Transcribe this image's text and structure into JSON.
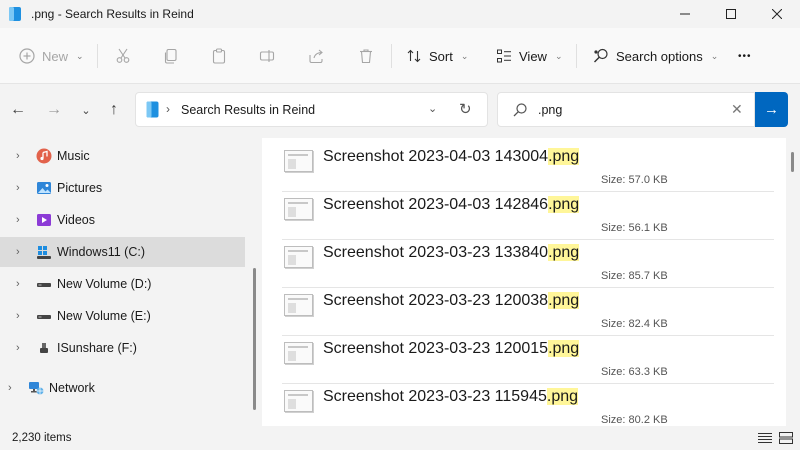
{
  "window": {
    "title": ".png - Search Results in Reind"
  },
  "toolbar": {
    "new_label": "New",
    "sort_label": "Sort",
    "view_label": "View",
    "search_options_label": "Search options",
    "more_label": "•••"
  },
  "address": {
    "path": "Search Results in Reind"
  },
  "search": {
    "value": ".png"
  },
  "nav": {
    "items": [
      {
        "label": "Music",
        "icon": "music-icon"
      },
      {
        "label": "Pictures",
        "icon": "pictures-icon"
      },
      {
        "label": "Videos",
        "icon": "videos-icon"
      },
      {
        "label": "Windows11 (C:)",
        "icon": "system-drive-icon",
        "selected": true
      },
      {
        "label": "New Volume (D:)",
        "icon": "drive-icon"
      },
      {
        "label": "New Volume (E:)",
        "icon": "drive-icon"
      },
      {
        "label": "ISunshare (F:)",
        "icon": "drive-icon"
      },
      {
        "label": "Network",
        "icon": "network-icon"
      }
    ]
  },
  "files": [
    {
      "stem": "Screenshot 2023-04-03 143004",
      "ext": ".png",
      "size_label": "Size:",
      "size": "57.0 KB"
    },
    {
      "stem": "Screenshot 2023-04-03 142846",
      "ext": ".png",
      "size_label": "Size:",
      "size": "56.1 KB"
    },
    {
      "stem": "Screenshot 2023-03-23 133840",
      "ext": ".png",
      "size_label": "Size:",
      "size": "85.7 KB"
    },
    {
      "stem": "Screenshot 2023-03-23 120038",
      "ext": ".png",
      "size_label": "Size:",
      "size": "82.4 KB"
    },
    {
      "stem": "Screenshot 2023-03-23 120015",
      "ext": ".png",
      "size_label": "Size:",
      "size": "63.3 KB"
    },
    {
      "stem": "Screenshot 2023-03-23 115945",
      "ext": ".png",
      "size_label": "Size:",
      "size": "80.2 KB"
    }
  ],
  "status": {
    "count": "2,230 items"
  },
  "colors": {
    "accent": "#0067c0",
    "highlight": "#fff699",
    "selected": "#dcdcdc"
  }
}
